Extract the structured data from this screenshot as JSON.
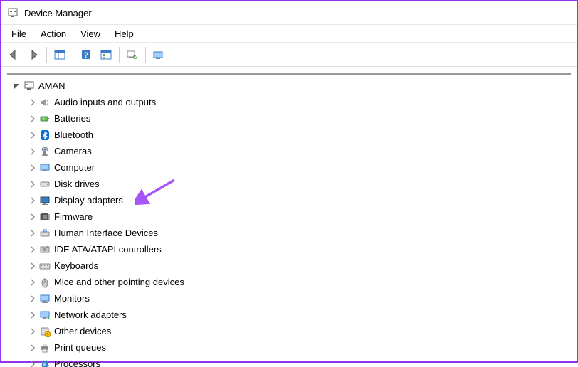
{
  "window": {
    "title": "Device Manager"
  },
  "menu": {
    "file": "File",
    "action": "Action",
    "view": "View",
    "help": "Help"
  },
  "tree": {
    "root": {
      "label": "AMAN",
      "expanded": true
    },
    "categories": [
      {
        "label": "Audio inputs and outputs",
        "icon": "speaker"
      },
      {
        "label": "Batteries",
        "icon": "battery"
      },
      {
        "label": "Bluetooth",
        "icon": "bluetooth"
      },
      {
        "label": "Cameras",
        "icon": "camera"
      },
      {
        "label": "Computer",
        "icon": "computer"
      },
      {
        "label": "Disk drives",
        "icon": "disk"
      },
      {
        "label": "Display adapters",
        "icon": "display"
      },
      {
        "label": "Firmware",
        "icon": "firmware"
      },
      {
        "label": "Human Interface Devices",
        "icon": "hid"
      },
      {
        "label": "IDE ATA/ATAPI controllers",
        "icon": "ide"
      },
      {
        "label": "Keyboards",
        "icon": "keyboard"
      },
      {
        "label": "Mice and other pointing devices",
        "icon": "mouse"
      },
      {
        "label": "Monitors",
        "icon": "monitor"
      },
      {
        "label": "Network adapters",
        "icon": "network"
      },
      {
        "label": "Other devices",
        "icon": "other"
      },
      {
        "label": "Print queues",
        "icon": "printer"
      },
      {
        "label": "Processors",
        "icon": "processor"
      }
    ]
  },
  "annotation": {
    "target": "Display adapters",
    "color": "#a855f7"
  }
}
